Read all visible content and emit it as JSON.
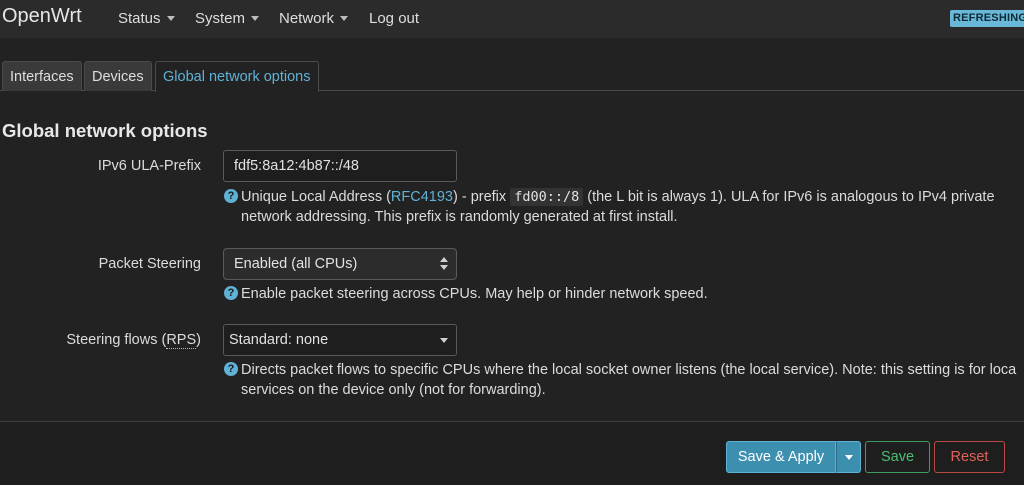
{
  "header": {
    "brand": "OpenWrt",
    "menu": [
      {
        "label": "Status",
        "dropdown": true
      },
      {
        "label": "System",
        "dropdown": true
      },
      {
        "label": "Network",
        "dropdown": true
      },
      {
        "label": "Log out",
        "dropdown": false
      }
    ],
    "indicator": "REFRESHING"
  },
  "tabs": [
    {
      "label": "Interfaces",
      "active": false
    },
    {
      "label": "Devices",
      "active": false
    },
    {
      "label": "Global network options",
      "active": true
    }
  ],
  "section": {
    "title": "Global network options"
  },
  "fields": {
    "ula_prefix": {
      "label": "IPv6 ULA-Prefix",
      "value": "fdf5:8a12:4b87::/48",
      "help_part1": "Unique Local Address (",
      "help_link": "RFC4193",
      "help_part2": ") - prefix ",
      "help_code": "fd00::/8",
      "help_part3": " (the L bit is always 1). ULA for IPv6 is analogous to IPv4 private",
      "help_line2": "network addressing. This prefix is randomly generated at first install."
    },
    "packet_steering": {
      "label": "Packet Steering",
      "value": "Enabled (all CPUs)",
      "help": "Enable packet steering across CPUs. May help or hinder network speed."
    },
    "steering_flows": {
      "label_prefix": "Steering flows (",
      "label_abbr": "RPS",
      "label_suffix": ")",
      "value": "Standard: none",
      "help_line1": "Directs packet flows to specific CPUs where the local socket owner listens (the local service). Note: this setting is for loca",
      "help_line2": "services on the device only (not for forwarding)."
    }
  },
  "actions": {
    "save_apply": "Save & Apply",
    "save": "Save",
    "reset": "Reset"
  },
  "colors": {
    "accent": "#5fb2d6",
    "save": "#4dbf73",
    "reset": "#e0625a"
  }
}
